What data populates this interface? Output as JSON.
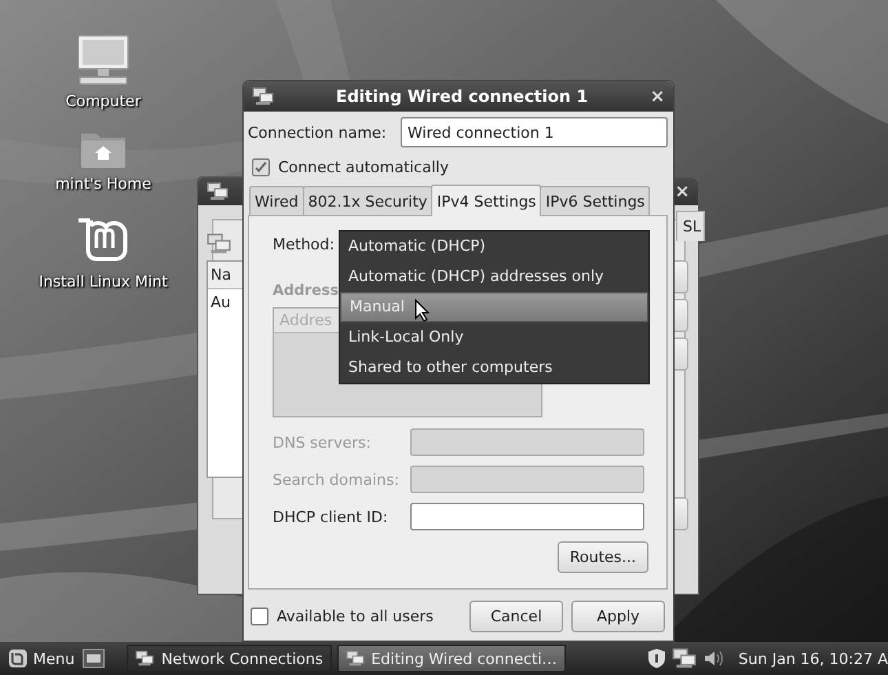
{
  "desktop_icons": [
    {
      "label": "Computer",
      "kind": "computer"
    },
    {
      "label": "mint's Home",
      "kind": "home"
    },
    {
      "label": "Install Linux Mint",
      "kind": "mint"
    }
  ],
  "back_window": {
    "close": "×",
    "tab": "SL",
    "column_header": "Na",
    "row": "Au"
  },
  "dialog": {
    "title": "Editing Wired connection 1",
    "close": "×",
    "connection_name": {
      "label": "Connection name:",
      "value": "Wired connection 1"
    },
    "connect_automatically": {
      "label": "Connect automatically",
      "checked": true
    },
    "tabs": [
      {
        "label": "Wired",
        "selected": false
      },
      {
        "label": "802.1x Security",
        "selected": false
      },
      {
        "label": "IPv4 Settings",
        "selected": true
      },
      {
        "label": "IPv6 Settings",
        "selected": false
      }
    ],
    "method": {
      "label": "Method:"
    },
    "method_menu": [
      {
        "label": "Automatic (DHCP)",
        "selected": false
      },
      {
        "label": "Automatic (DHCP) addresses only",
        "selected": false
      },
      {
        "label": "Manual",
        "selected": true
      },
      {
        "label": "Link-Local Only",
        "selected": false
      },
      {
        "label": "Shared to other computers",
        "selected": false
      }
    ],
    "addresses": {
      "label": "Address",
      "column_header": "Addres"
    },
    "fields": [
      {
        "label": "DNS servers:",
        "disabled": true
      },
      {
        "label": "Search domains:",
        "disabled": true
      },
      {
        "label": "DHCP client ID:",
        "disabled": false
      }
    ],
    "routes_button": {
      "label": "Routes..."
    },
    "available_to_all_users": {
      "label": "Available to all users",
      "checked": false
    },
    "buttons": [
      {
        "label": "Cancel"
      },
      {
        "label": "Apply"
      }
    ]
  },
  "taskbar": {
    "menu": "Menu",
    "windows": [
      {
        "label": "Network Connections",
        "selected": false
      },
      {
        "label": "Editing Wired connecti…",
        "selected": true
      }
    ],
    "clock": "Sun Jan 16, 10:27 A"
  }
}
